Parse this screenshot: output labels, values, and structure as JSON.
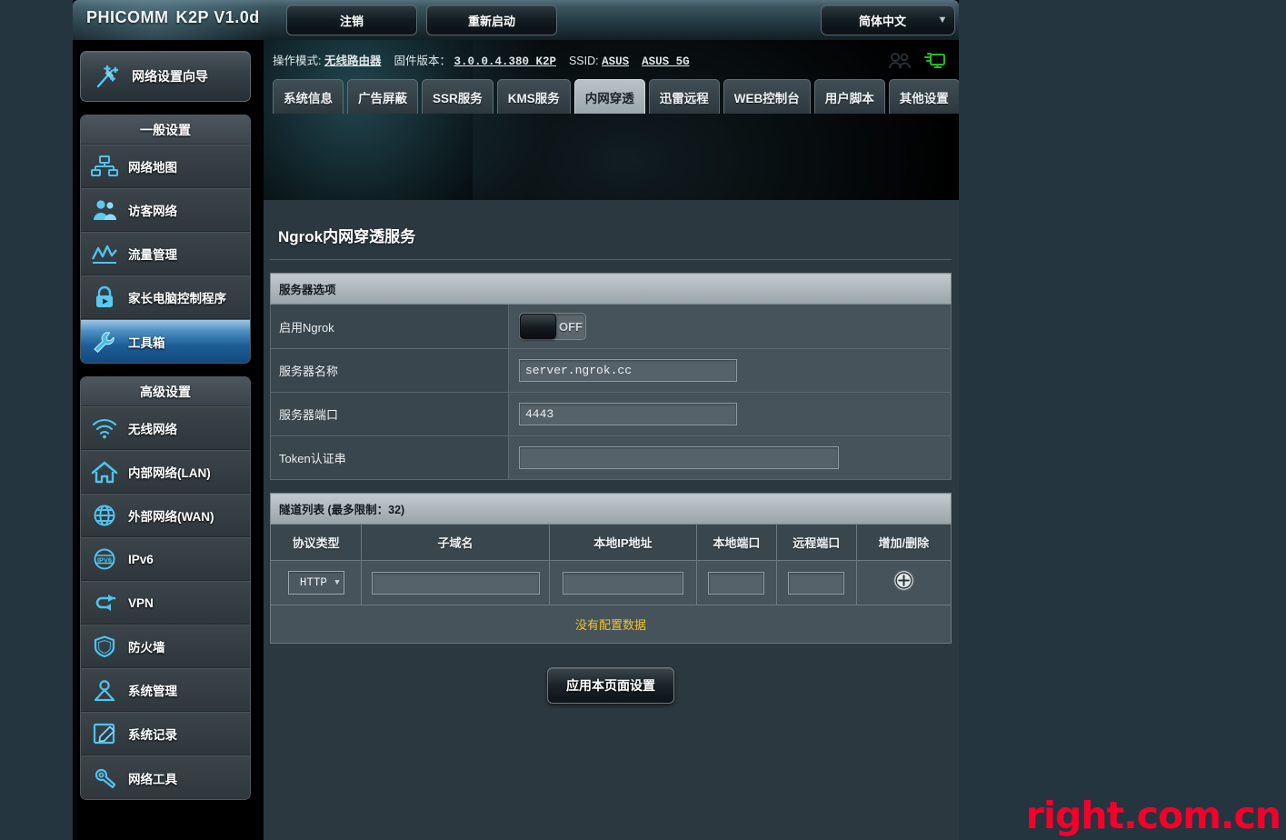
{
  "header": {
    "brand": "PHICOMM",
    "model": "K2P V1.0d",
    "logout_label": "注销",
    "reboot_label": "重新启动",
    "language": "简体中文",
    "caret_icon": "chevron-down-icon"
  },
  "info": {
    "mode_label": "操作模式:",
    "mode_value": "无线路由器",
    "firmware_label": "固件版本：",
    "firmware_value": "3.0.0.4.380_K2P",
    "ssid_label": "SSID:",
    "ssid_1": "ASUS",
    "ssid_2": "ASUS_5G",
    "clients_icon": "clients-icon",
    "usb_icon": "network-monitor-icon"
  },
  "tabs": [
    {
      "label": "系统信息",
      "active": false
    },
    {
      "label": "广告屏蔽",
      "active": false
    },
    {
      "label": "SSR服务",
      "active": false
    },
    {
      "label": "KMS服务",
      "active": false
    },
    {
      "label": "内网穿透",
      "active": true
    },
    {
      "label": "迅雷远程",
      "active": false
    },
    {
      "label": "WEB控制台",
      "active": false
    },
    {
      "label": "用户脚本",
      "active": false
    },
    {
      "label": "其他设置",
      "active": false
    }
  ],
  "sidebar": {
    "wizard": {
      "label": "网络设置向导",
      "icon": "wand-icon"
    },
    "general": {
      "title": "一般设置",
      "items": [
        {
          "label": "网络地图",
          "icon": "network-map-icon",
          "active": false
        },
        {
          "label": "访客网络",
          "icon": "guest-network-icon",
          "active": false
        },
        {
          "label": "流量管理",
          "icon": "traffic-manager-icon",
          "active": false
        },
        {
          "label": "家长电脑控制程序",
          "icon": "parental-control-icon",
          "active": false
        },
        {
          "label": "工具箱",
          "icon": "wrench-icon",
          "active": true
        }
      ]
    },
    "advanced": {
      "title": "高级设置",
      "items": [
        {
          "label": "无线网络",
          "icon": "wifi-icon",
          "active": false
        },
        {
          "label": "内部网络(LAN)",
          "icon": "home-icon",
          "active": false
        },
        {
          "label": "外部网络(WAN)",
          "icon": "globe-icon",
          "active": false
        },
        {
          "label": "IPv6",
          "icon": "ipv6-icon",
          "active": false
        },
        {
          "label": "VPN",
          "icon": "vpn-icon",
          "active": false
        },
        {
          "label": "防火墙",
          "icon": "shield-icon",
          "active": false
        },
        {
          "label": "系统管理",
          "icon": "admin-user-icon",
          "active": false
        },
        {
          "label": "系统记录",
          "icon": "system-log-icon",
          "active": false
        },
        {
          "label": "网络工具",
          "icon": "network-tools-icon",
          "active": false
        }
      ]
    }
  },
  "main": {
    "page_title": "Ngrok内网穿透服务",
    "server_options": {
      "section_title": "服务器选项",
      "enable_label": "启用Ngrok",
      "enable_state": "OFF",
      "server_name_label": "服务器名称",
      "server_name_value": "server.ngrok.cc",
      "server_port_label": "服务器端口",
      "server_port_value": "4443",
      "token_label": "Token认证串",
      "token_value": ""
    },
    "tunnel_list": {
      "section_title": "隧道列表 (最多限制：32)",
      "columns": [
        "协议类型",
        "子域名",
        "本地IP地址",
        "本地端口",
        "远程端口",
        "增加/删除"
      ],
      "new_row": {
        "protocol": "HTTP",
        "subdomain": "",
        "local_ip": "",
        "local_port": "",
        "remote_port": "",
        "add_icon": "add-circle-icon"
      },
      "empty_message": "没有配置数据"
    },
    "apply_label": "应用本页面设置"
  },
  "watermark": {
    "text": "right.com.cn",
    "color": "#f5002b"
  }
}
